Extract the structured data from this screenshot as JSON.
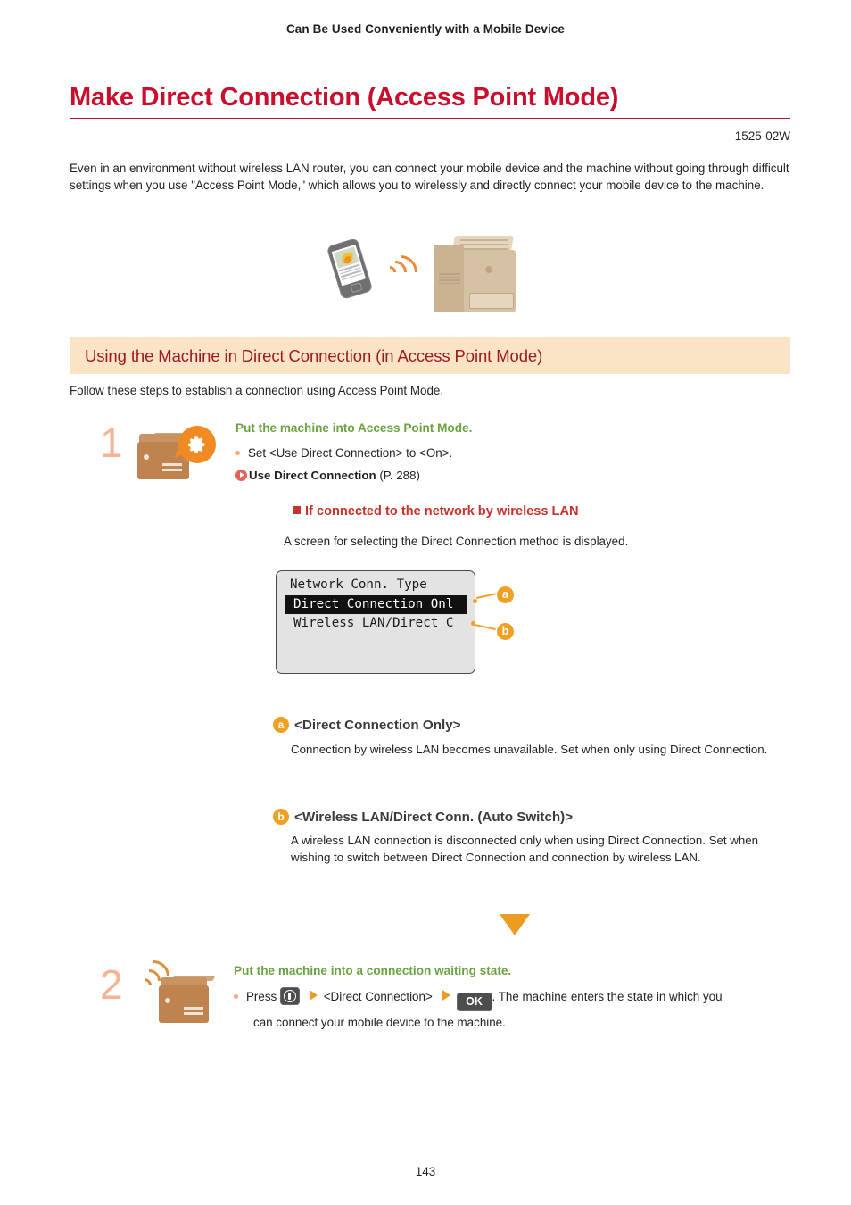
{
  "header": {
    "running_header": "Can Be Used Conveniently with a Mobile Device",
    "title": "Make Direct Connection (Access Point Mode)",
    "doc_code": "1525-02W",
    "title_color": "#C8102E"
  },
  "intro": {
    "paragraph": "Even in an environment without wireless LAN router, you can connect your mobile device and the machine without going through difficult settings when you use \"Access Point Mode,\" which allows you to wirelessly and directly connect your mobile device to the machine."
  },
  "illustration": {
    "phone_icon": "mobile-phone-icon",
    "waves_icon": "wireless-waves-icon",
    "printer_icon": "printer-icon"
  },
  "section": {
    "band_title": "Using the Machine in Direct Connection (in Access Point Mode)",
    "band_bg": "#FBE3C6",
    "band_text_color": "#9E1B24",
    "follow_text": "Follow these steps to establish a connection using Access Point Mode."
  },
  "steps": [
    {
      "number": "1",
      "heading": "Put the machine into Access Point Mode.",
      "bullet": "Set <Use Direct Connection> to <On>.",
      "xref_label": "Use Direct Connection",
      "xref_page": "(P. 288)"
    },
    {
      "number": "2",
      "heading": "Put the machine into a connection waiting state.",
      "press_label": "Press",
      "menu_key": "mobile-portal-key",
      "menu_item": "<Direct Connection>",
      "ok_key": "OK",
      "tail_text": ". The machine enters the state in which you",
      "tail_text_2": "can connect your mobile device to the machine."
    }
  ],
  "subsection": {
    "heading": "If connected to the network by wireless LAN",
    "heading_color": "#C8322B",
    "body": "A screen for selecting the Direct Connection method is displayed."
  },
  "lcd": {
    "title": "Network Conn. Type",
    "rows": [
      {
        "text": "Direct Connection Onl",
        "selected": true,
        "badge": "a"
      },
      {
        "text": "Wireless LAN/Direct C",
        "selected": false,
        "badge": "b"
      }
    ]
  },
  "callouts": [
    {
      "badge": "a",
      "heading": "<Direct Connection Only>",
      "body": "Connection by wireless LAN becomes unavailable. Set when only using Direct Connection."
    },
    {
      "badge": "b",
      "heading": "<Wireless LAN/Direct Conn. (Auto Switch)>",
      "body": "A wireless LAN connection is disconnected only when using Direct Connection. Set when wishing to switch between Direct Connection and connection by wireless LAN."
    }
  ],
  "flow": {
    "arrow_icon": "down-triangle-icon",
    "arrow_color": "#EB9A22"
  },
  "footer": {
    "page_number": "143"
  }
}
